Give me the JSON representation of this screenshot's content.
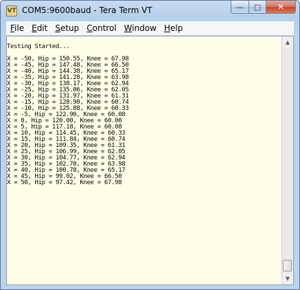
{
  "window": {
    "title": "COM5:9600baud - Tera Term VT",
    "icon": "tera-term-app-icon",
    "icon_glyph": "VT"
  },
  "caption_buttons": {
    "minimize_glyph": "—",
    "maximize_glyph": "□",
    "close_glyph": "✕"
  },
  "menu": [
    {
      "accel": "F",
      "rest": "ile"
    },
    {
      "accel": "E",
      "rest": "dit"
    },
    {
      "accel": "S",
      "rest": "etup"
    },
    {
      "accel": "C",
      "rest": "ontrol"
    },
    {
      "accel": "W",
      "rest": "indow"
    },
    {
      "accel": "H",
      "rest": "elp"
    }
  ],
  "terminal": {
    "background": "#ffffe8",
    "lines": [
      "",
      "Testing Started...",
      "",
      "X = -50, Hip = 150.55, Knee = 67.98",
      "X = -45, Hip = 147.48, Knee = 66.50",
      "X = -40, Hip = 144.38, Knee = 65.17",
      "X = -35, Hip = 141.28, Knee = 63.98",
      "X = -30, Hip = 138.17, Knee = 62.94",
      "X = -25, Hip = 135.06, Knee = 62.05",
      "X = -20, Hip = 131.97, Knee = 61.31",
      "X = -15, Hip = 128.90, Knee = 60.74",
      "X = -10, Hip = 125.88, Knee = 60.33",
      "X = -5, Hip = 122.90, Knee = 60.08",
      "X = 0, Hip = 120.00, Knee = 60.00",
      "X = 5, Hip = 117.18, Knee = 60.08",
      "X = 10, Hip = 114.45, Knee = 60.33",
      "X = 15, Hip = 111.84, Knee = 60.74",
      "X = 20, Hip = 109.35, Knee = 61.31",
      "X = 25, Hip = 106.99, Knee = 62.05",
      "X = 30, Hip = 104.77, Knee = 62.94",
      "X = 35, Hip = 102.70, Knee = 63.98",
      "X = 40, Hip = 100.78, Knee = 65.17",
      "X = 45, Hip = 99.02, Knee = 66.50",
      "X = 50, Hip = 97.42, Knee = 67.98"
    ]
  },
  "scrollbar": {
    "up_glyph": "▲",
    "down_glyph": "▼"
  }
}
